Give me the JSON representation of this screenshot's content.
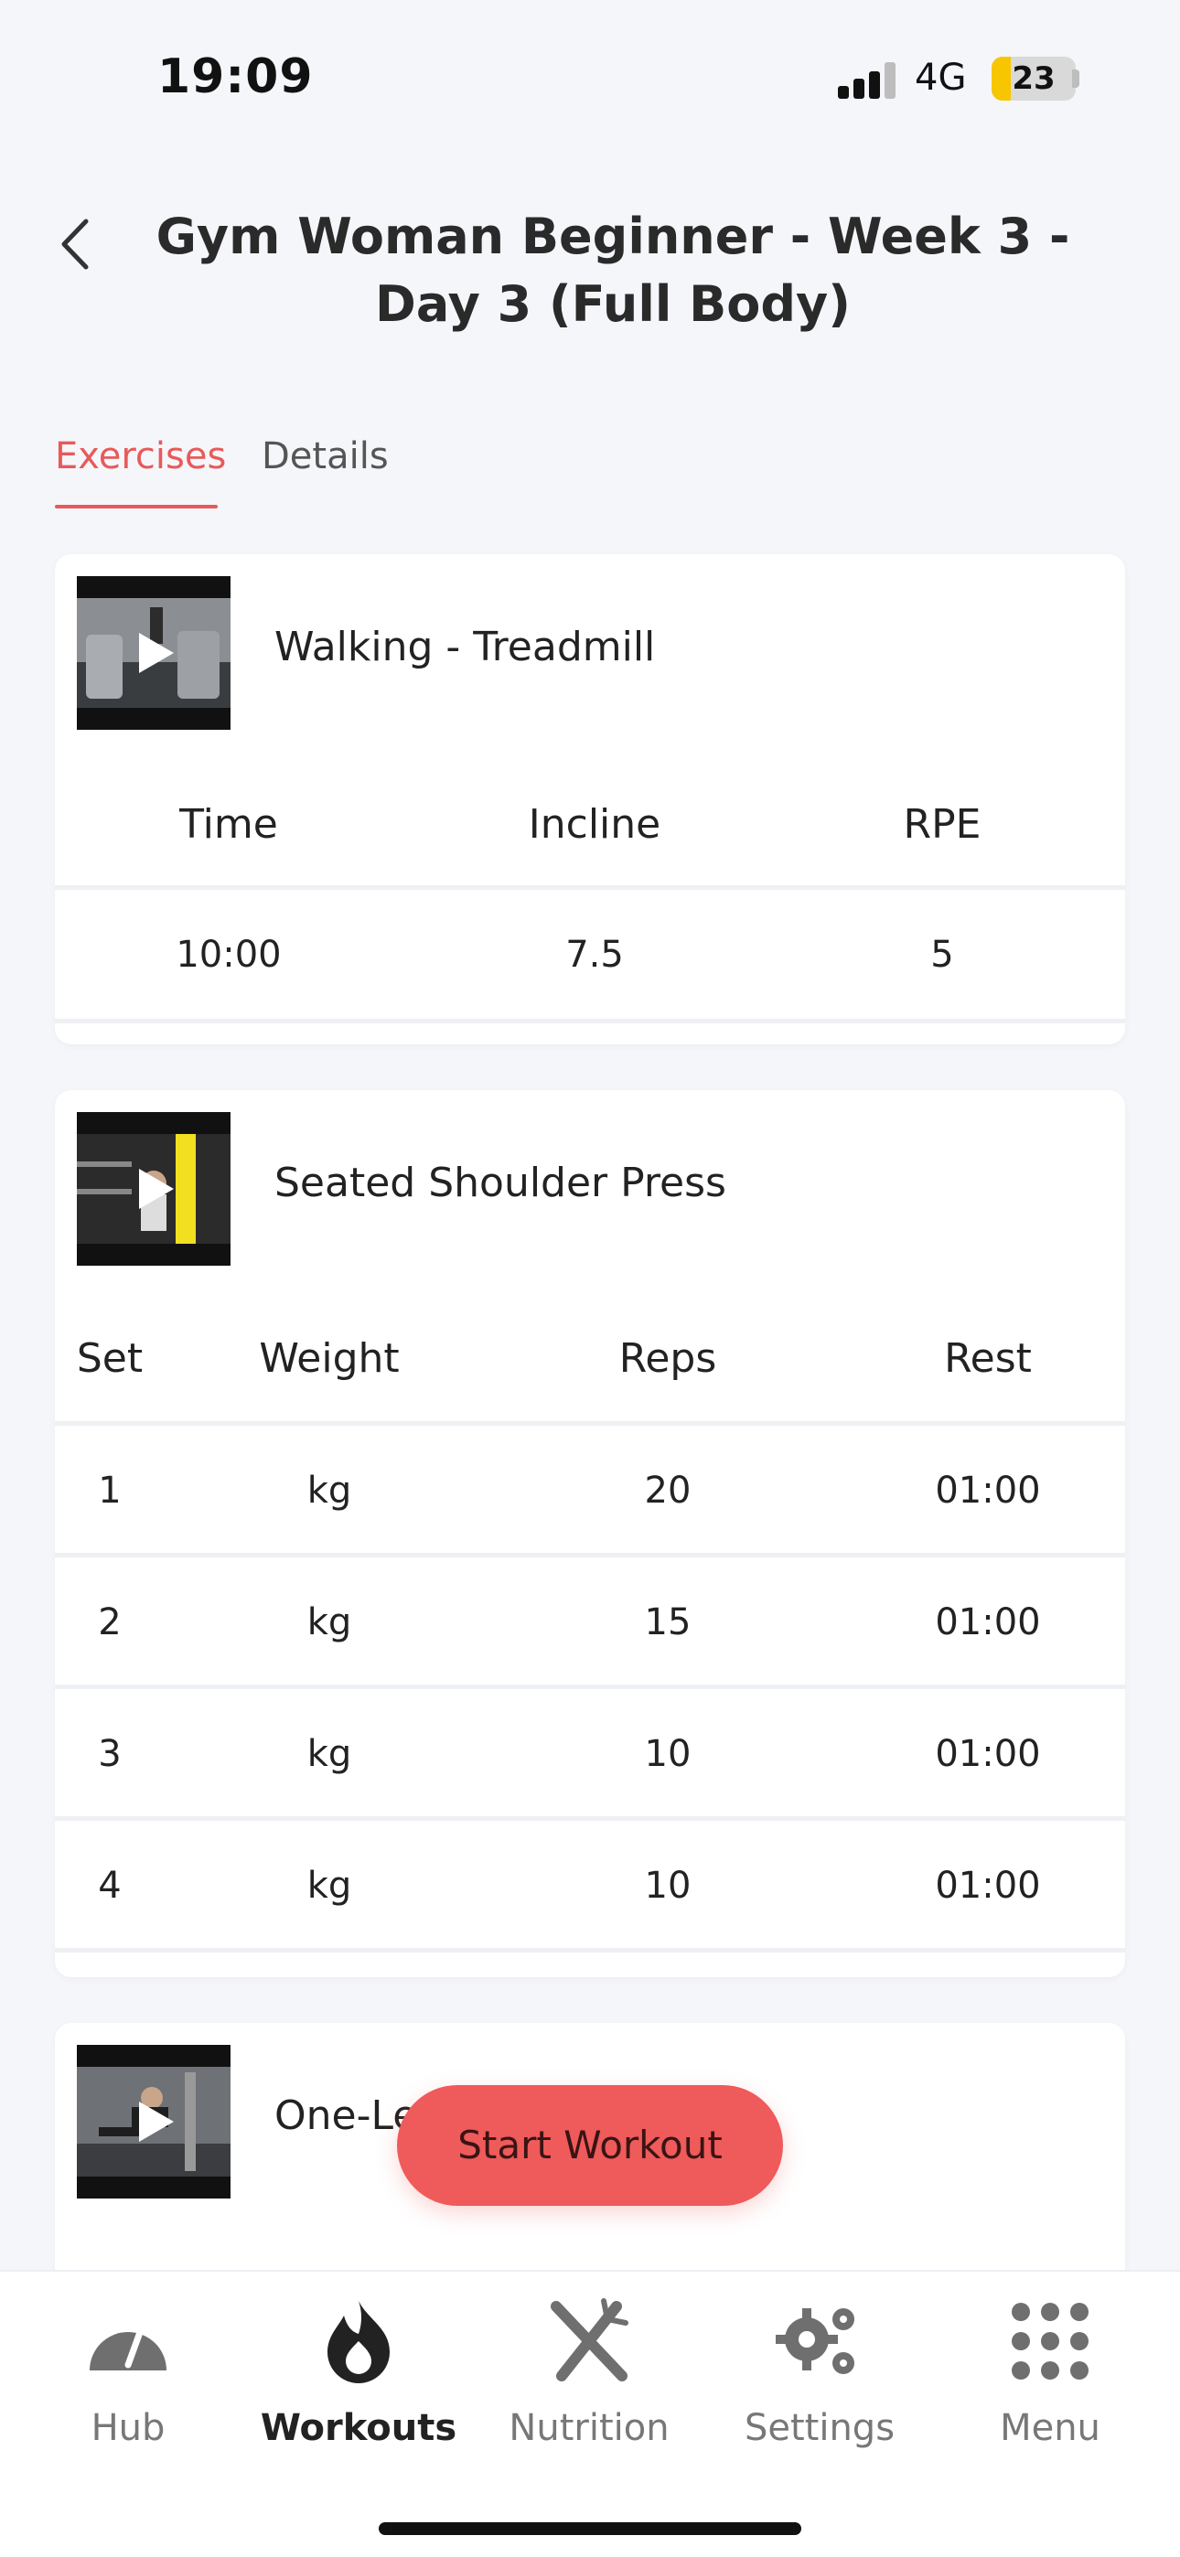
{
  "status_bar": {
    "time": "19:09",
    "network": "4G",
    "battery": "23",
    "battery_level_pct": 23
  },
  "header": {
    "back_icon": "chevron-left-icon",
    "title": "Gym Woman Beginner - Week 3 - Day 3 (Full Body)"
  },
  "tabs": [
    {
      "label": "Exercises",
      "active": true
    },
    {
      "label": "Details",
      "active": false
    }
  ],
  "exercises": [
    {
      "name": "Walking - Treadmill",
      "columns": [
        "Time",
        "Incline",
        "RPE"
      ],
      "rows": [
        [
          "10:00",
          "7.5",
          "5"
        ]
      ]
    },
    {
      "name": "Seated Shoulder Press",
      "columns": [
        "Set",
        "Weight",
        "Reps",
        "Rest"
      ],
      "rows": [
        [
          "1",
          "kg",
          "20",
          "01:00"
        ],
        [
          "2",
          "kg",
          "15",
          "01:00"
        ],
        [
          "3",
          "kg",
          "10",
          "01:00"
        ],
        [
          "4",
          "kg",
          "10",
          "01:00"
        ]
      ]
    },
    {
      "name": "One-Leg Cable Kickback"
    }
  ],
  "start_button": {
    "label": "Start Workout"
  },
  "bottom_nav": [
    {
      "label": "Hub",
      "icon": "gauge-icon",
      "active": false
    },
    {
      "label": "Workouts",
      "icon": "flame-icon",
      "active": true
    },
    {
      "label": "Nutrition",
      "icon": "fork-knife-icon",
      "active": false
    },
    {
      "label": "Settings",
      "icon": "gears-icon",
      "active": false
    },
    {
      "label": "Menu",
      "icon": "grid-dots-icon",
      "active": false
    }
  ],
  "colors": {
    "accent": "#e85a5a",
    "button": "#ef5a5a",
    "background": "#f5f6fa",
    "battery": "#f7c600"
  }
}
